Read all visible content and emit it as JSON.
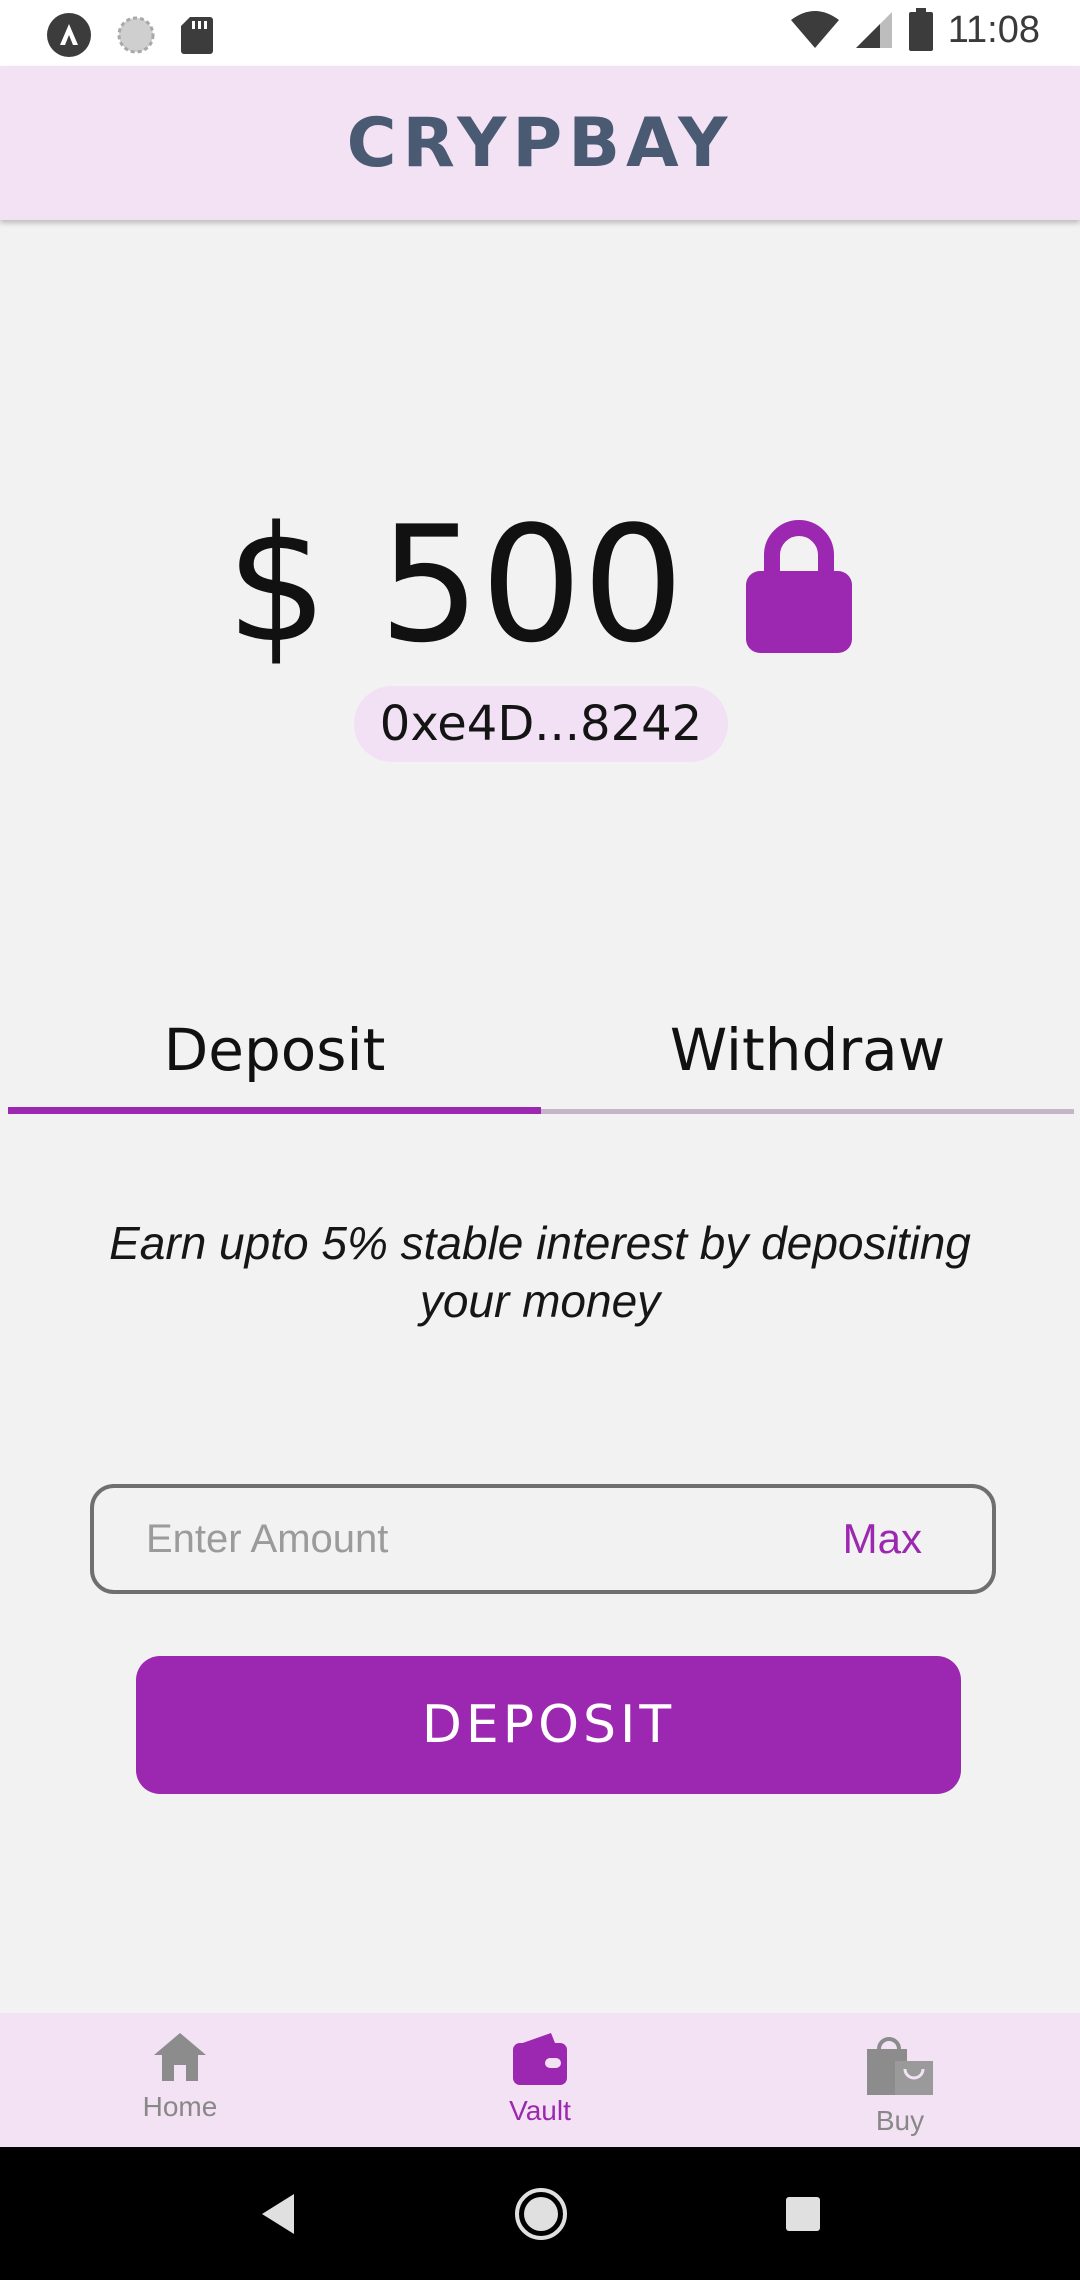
{
  "status_bar": {
    "time": "11:08",
    "icons": [
      "app-logo-icon",
      "sync-icon",
      "sd-card-icon",
      "wifi-icon",
      "signal-icon",
      "battery-icon"
    ]
  },
  "header": {
    "title": "CRYPBAY"
  },
  "vault": {
    "balance": "$ 500",
    "address": "0xe4D...8242",
    "lock_icon": "lock-icon"
  },
  "tabs": [
    {
      "label": "Deposit",
      "active": true
    },
    {
      "label": "Withdraw",
      "active": false
    }
  ],
  "deposit_panel": {
    "info": "Earn upto 5% stable interest by depositing your money",
    "amount_placeholder": "Enter Amount",
    "max_label": "Max",
    "submit_label": "DEPOSIT"
  },
  "bottom_nav": [
    {
      "label": "Home",
      "icon": "home-icon",
      "active": false
    },
    {
      "label": "Vault",
      "icon": "wallet-icon",
      "active": true
    },
    {
      "label": "Buy",
      "icon": "shopping-bag-icon",
      "active": false
    }
  ],
  "system_nav": [
    "back-icon",
    "home-circle-icon",
    "recents-icon"
  ],
  "colors": {
    "accent": "#9c27b0",
    "header_bg": "#f2e2f4",
    "page_bg": "#f2f2f2",
    "title": "#4a5a73",
    "inactive": "#888888"
  }
}
